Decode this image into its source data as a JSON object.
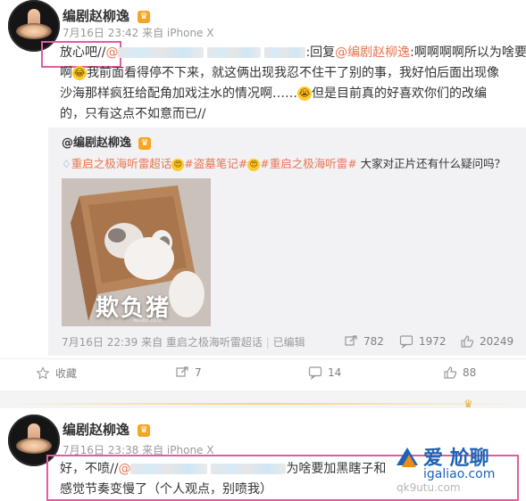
{
  "post1": {
    "username": "编剧赵柳逸",
    "meta": "7月16日 23:42 来自 iPhone X",
    "text": {
      "p1_pre": "放心吧//",
      "p1_at": "@",
      "p1_mid": ":回复",
      "p1_at2": "@编剧赵柳逸",
      "p1_post": ":啊啊啊啊所以为啥要加",
      "p2": "啊",
      "p2_rest": "我前面看得停不下来，就这俩出现我忍不住干了别的事，我好怕后面出现像",
      "p3": "沙海那样疯狂给配角加戏注水的情况啊……",
      "p3_rest": "但是目前真的好喜欢你们的改编",
      "p4": "的，只有这点不如意而已//"
    },
    "repost": {
      "author": "@编剧赵柳逸",
      "topic1": "重启之极海听雷超话",
      "topic2": "#盗墓笔记#",
      "topic3": "#重启之极海听雷#",
      "tail": " 大家对正片还有什么疑问吗？",
      "image_caption": "欺负猪",
      "image_watermark": "weibo.com",
      "meta": "7月16日 22:39 来自 重启之极海听雷超话",
      "edit": "已编辑",
      "shares": "782",
      "comments": "1972",
      "likes": "20249"
    },
    "actions": {
      "collect": "收藏",
      "share": "7",
      "comment": "14",
      "like": "88"
    }
  },
  "post2": {
    "username": "编剧赵柳逸",
    "meta": "7月16日 23:38 来自 iPhone X",
    "text": {
      "l1_pre": "好，不喷//",
      "l1_at": "@",
      "l1_post": "为啥要加黑瞎子和",
      "l2": "感觉节奏变慢了（个人观点，别喷我）"
    }
  },
  "watermark": {
    "site_cn": "爱 尬聊",
    "domain1": "igaliao.com",
    "domain2": "qk9utu.com"
  },
  "colors": {
    "accent": "#eb7350",
    "highlight_border": "#e25ca0",
    "topic_icon": "#5a8fd8"
  }
}
